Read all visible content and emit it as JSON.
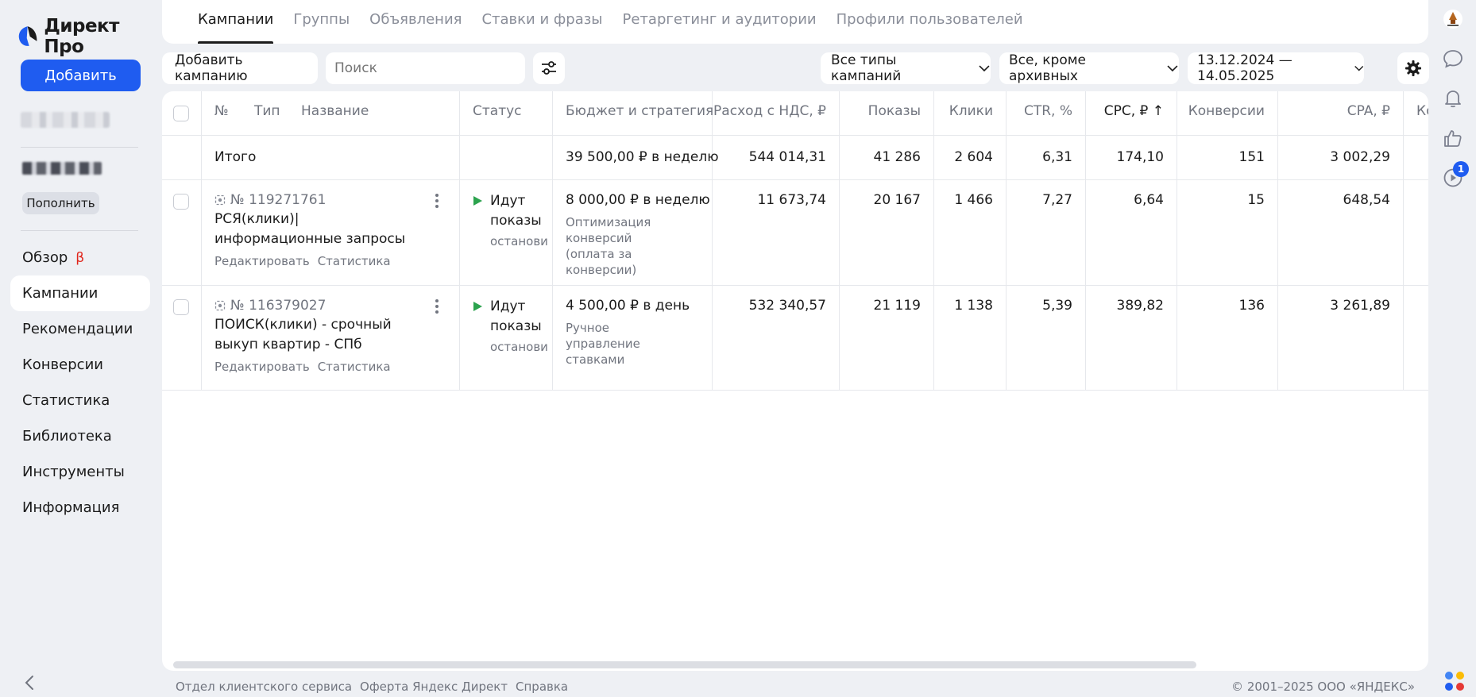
{
  "brand": {
    "name": "Директ Про",
    "accent": "#1f5cf0"
  },
  "sidebar": {
    "add_label": "Добавить",
    "topup_label": "Пополнить",
    "nav": [
      {
        "label": "Обзор",
        "badge": "β"
      },
      {
        "label": "Кампании",
        "active": true
      },
      {
        "label": "Рекомендации"
      },
      {
        "label": "Конверсии"
      },
      {
        "label": "Статистика"
      },
      {
        "label": "Библиотека"
      },
      {
        "label": "Инструменты"
      },
      {
        "label": "Информация"
      }
    ]
  },
  "tabs": [
    "Кампании",
    "Группы",
    "Объявления",
    "Ставки и фразы",
    "Ретаргетинг и аудитории",
    "Профили пользователей"
  ],
  "toolbar": {
    "add_campaign": "Добавить кампанию",
    "search_placeholder": "Поиск",
    "campaign_types": "Все типы кампаний",
    "status_filter": "Все, кроме архивных",
    "date_range": "13.12.2024 — 14.05.2025"
  },
  "table": {
    "headers": {
      "num": "№",
      "type": "Тип",
      "name": "Название",
      "status": "Статус",
      "budget": "Бюджет и стратегия",
      "spend": "Расход с НДС, ₽",
      "impressions": "Показы",
      "clicks": "Клики",
      "ctr": "CTR, %",
      "cpc": "CPC, ₽ ↑",
      "conversions": "Конверсии",
      "cpa": "CPA, ₽",
      "more": "Ко"
    },
    "total": {
      "label": "Итого",
      "budget": "39 500,00 ₽ в неделю",
      "spend": "544 014,31",
      "impressions": "41 286",
      "clicks": "2 604",
      "ctr": "6,31",
      "cpc": "174,10",
      "conversions": "151",
      "cpa": "3 002,29"
    },
    "rows": [
      {
        "id": "№ 119271761",
        "name": "РСЯ(клики)| информационные запросы",
        "edit": "Редактировать",
        "stats": "Статистика",
        "status": "Идут показы",
        "status_sub": "останови",
        "budget": "8 000,00 ₽ в неделю",
        "strategy": "Оптимизация конверсий (оплата за конверсии)",
        "spend": "11 673,74",
        "impressions": "20 167",
        "clicks": "1 466",
        "ctr": "7,27",
        "cpc": "6,64",
        "conversions": "15",
        "cpa": "648,54"
      },
      {
        "id": "№ 116379027",
        "name": "ПОИСК(клики) - срочный выкуп квартир - СПб",
        "edit": "Редактировать",
        "stats": "Статистика",
        "status": "Идут показы",
        "status_sub": "останови",
        "budget": "4 500,00 ₽ в день",
        "strategy": "Ручное управление ставками",
        "spend": "532 340,57",
        "impressions": "21 119",
        "clicks": "1 138",
        "ctr": "5,39",
        "cpc": "389,82",
        "conversions": "136",
        "cpa": "3 261,89"
      }
    ]
  },
  "footer": {
    "links": [
      "Отдел клиентского сервиса",
      "Оферта Яндекс Директ",
      "Справка"
    ],
    "copyright": "© 2001–2025 ООО «ЯНДЕКС»"
  },
  "rail": {
    "notification_count": "1"
  }
}
